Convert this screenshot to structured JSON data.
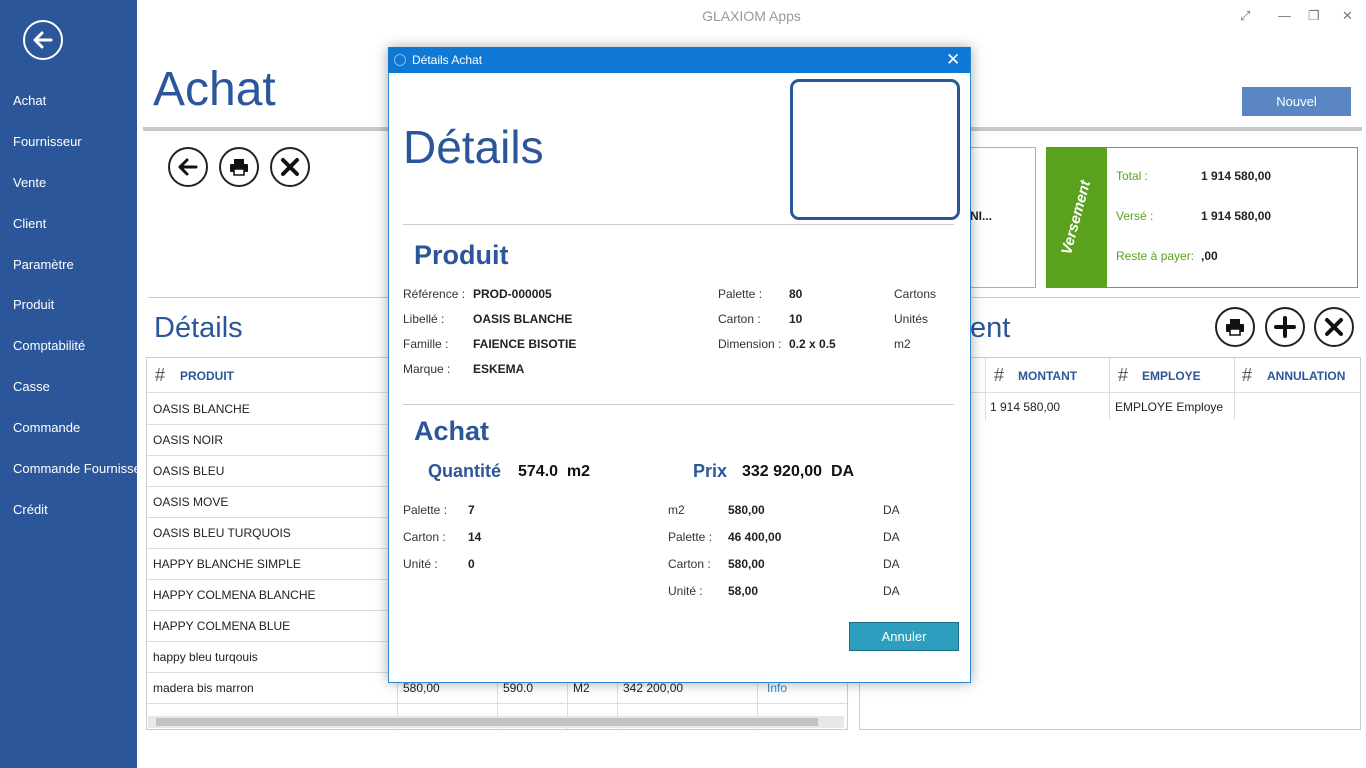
{
  "app": {
    "title": "GLAXIOM Apps"
  },
  "sidebar": {
    "items": [
      {
        "label": "Achat"
      },
      {
        "label": "Fournisseur"
      },
      {
        "label": "Vente"
      },
      {
        "label": "Client"
      },
      {
        "label": "Paramètre"
      },
      {
        "label": "Produit"
      },
      {
        "label": "Comptabilité"
      },
      {
        "label": "Casse"
      },
      {
        "label": "Commande"
      },
      {
        "label": "Commande Fournisseur"
      },
      {
        "label": "Crédit"
      }
    ]
  },
  "main": {
    "title": "Achat",
    "new_button": "Nouvel",
    "details_label": "Détails",
    "paiement_label_visible": "ent",
    "orange_card_text": "NI...",
    "versement": {
      "band_label": "Versement",
      "total_label": "Total :",
      "total_value": "1 914 580,00",
      "verse_label": "Versé :",
      "verse_value": "1 914 580,00",
      "reste_label": "Reste à payer:",
      "reste_value": ",00"
    },
    "products_table": {
      "header": "PRODUIT",
      "rows": [
        {
          "produit": "OASIS BLANCHE"
        },
        {
          "produit": "OASIS NOIR"
        },
        {
          "produit": "OASIS BLEU"
        },
        {
          "produit": "OASIS MOVE"
        },
        {
          "produit": "OASIS BLEU TURQUOIS"
        },
        {
          "produit": "HAPPY BLANCHE SIMPLE"
        },
        {
          "produit": "HAPPY COLMENA BLANCHE"
        },
        {
          "produit": "HAPPY COLMENA BLUE"
        },
        {
          "produit": "happy bleu turqouis"
        },
        {
          "produit": "madera bis marron",
          "prix": "580,00",
          "qte": "590.0",
          "unite": "M2",
          "montant": "342 200,00",
          "link": "Info"
        }
      ]
    },
    "pay_table": {
      "headers": [
        "MONTANT",
        "EMPLOYE",
        "ANNULATION"
      ],
      "rows": [
        {
          "montant": "1 914 580,00",
          "employe": "EMPLOYE Employe",
          "annulation": ""
        }
      ]
    }
  },
  "modal": {
    "title": "Détails Achat",
    "heading": "Détails",
    "produit_section": "Produit",
    "produit": {
      "reference_label": "Référence :",
      "reference": "PROD-000005",
      "libelle_label": "Libellé :",
      "libelle": "OASIS BLANCHE",
      "famille_label": "Famille :",
      "famille": "FAIENCE BISOTIE",
      "marque_label": "Marque :",
      "marque": "ESKEMA",
      "palette_label": "Palette :",
      "palette": "80",
      "palette_unit": "Cartons",
      "carton_label": "Carton :",
      "carton": "10",
      "carton_unit": "Unités",
      "dimension_label": "Dimension :",
      "dimension": "0.2 x 0.5",
      "dimension_unit": "m2"
    },
    "achat_section": "Achat",
    "achat": {
      "quantite_label": "Quantité",
      "quantite_value": "574.0  m2",
      "prix_label": "Prix",
      "prix_value": "332 920,00  DA",
      "palette_label": "Palette :",
      "palette": "7",
      "carton_label": "Carton :",
      "carton": "14",
      "unite_label": "Unité :",
      "unite": "0",
      "p_m2_label": "m2",
      "p_m2": "580,00",
      "p_palette_label": "Palette :",
      "p_palette": "46 400,00",
      "p_carton_label": "Carton :",
      "p_carton": "580,00",
      "p_unite_label": "Unité :",
      "p_unite": "58,00",
      "currency": "DA"
    },
    "cancel_button": "Annuler"
  }
}
